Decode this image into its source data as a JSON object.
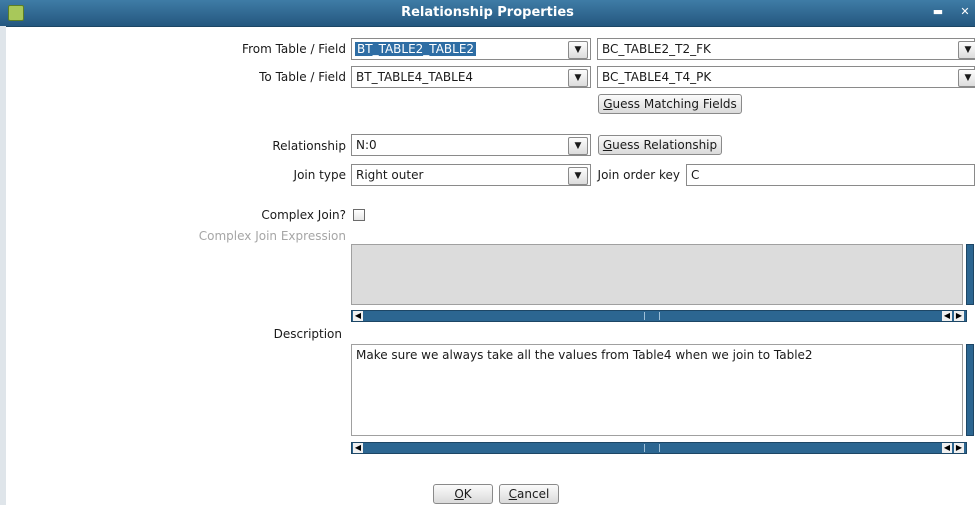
{
  "window": {
    "title": "Relationship Properties",
    "minimize_glyph": "▬",
    "close_glyph": "✕"
  },
  "from": {
    "label": "From Table / Field",
    "table_value": "BT_TABLE2_TABLE2",
    "field_value": "BC_TABLE2_T2_FK"
  },
  "to": {
    "label": "To Table / Field",
    "table_value": "BT_TABLE4_TABLE4",
    "field_value": "BC_TABLE4_T4_PK"
  },
  "guess_matching_fields_label_first": "G",
  "guess_matching_fields_label_rest": "uess Matching Fields",
  "relationship": {
    "label": "Relationship",
    "value": "N:0",
    "guess_label_first": "G",
    "guess_label_rest": "uess Relationship"
  },
  "join_type": {
    "label": "Join type",
    "value": "Right outer"
  },
  "join_order_key": {
    "label": "Join order key",
    "value": "C"
  },
  "complex_join": {
    "label": "Complex Join?",
    "checked": false,
    "expression_label": "Complex Join Expression"
  },
  "description": {
    "label": "Description",
    "value": "Make sure we always take all the values from Table4 when we join to Table2"
  },
  "buttons": {
    "ok_first": "O",
    "ok_rest": "K",
    "cancel_first": "C",
    "cancel_rest": "ancel"
  },
  "icons": {
    "dropdown": "chevron-down-icon",
    "scroll_left": "arrow-left-icon",
    "scroll_right": "arrow-right-icon"
  },
  "colors": {
    "titlebar": "#24577f",
    "scrollbar": "#2c6691",
    "selection": "#2e6da4"
  }
}
